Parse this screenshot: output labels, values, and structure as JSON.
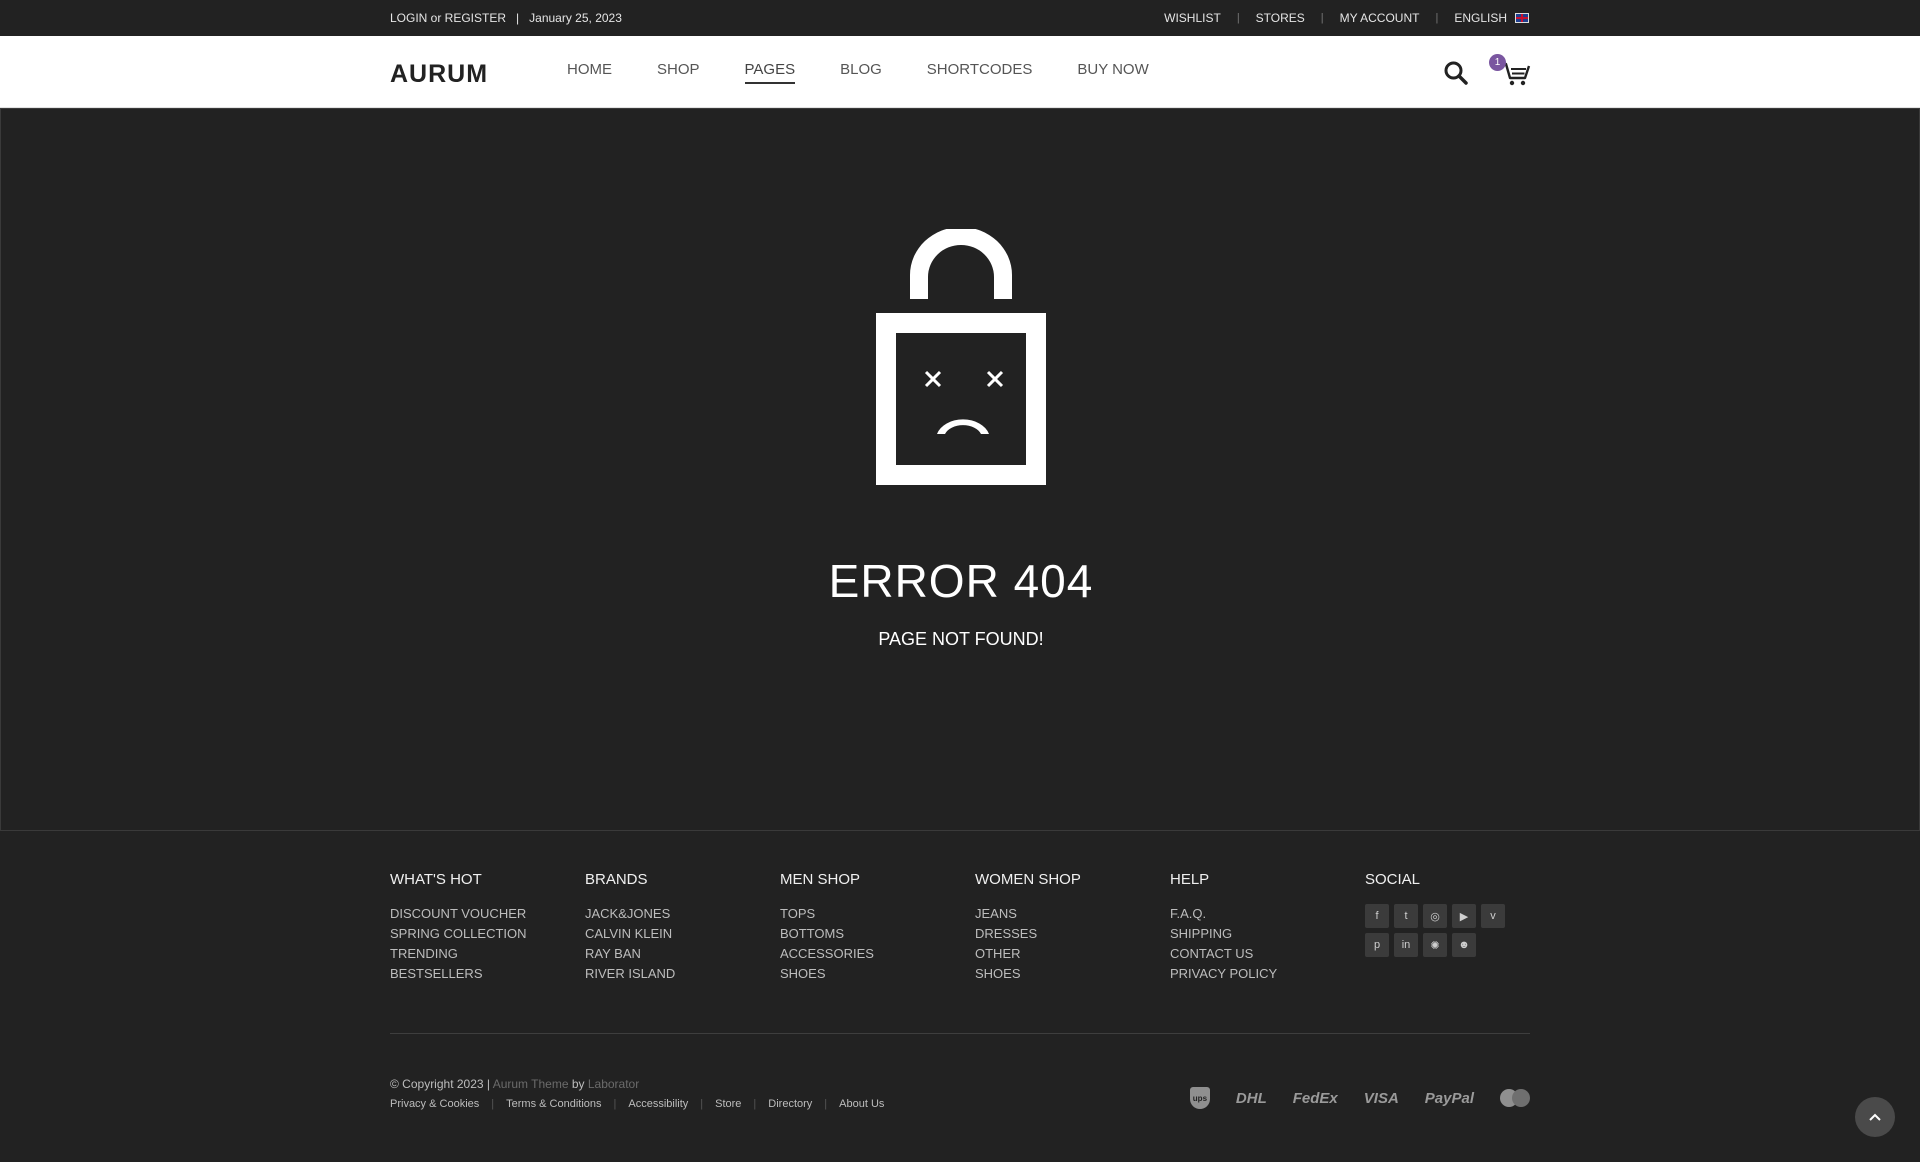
{
  "topbar": {
    "login": "LOGIN or REGISTER",
    "divider": "|",
    "date": "January 25, 2023",
    "links": [
      "WISHLIST",
      "STORES",
      "MY ACCOUNT"
    ],
    "language": "ENGLISH",
    "sep": "|"
  },
  "header": {
    "logo": "AURUM",
    "nav": [
      "HOME",
      "SHOP",
      "PAGES",
      "BLOG",
      "SHORTCODES",
      "BUY NOW"
    ],
    "active_nav": "PAGES",
    "cart_count": "1",
    "icons": {
      "search": "search-icon",
      "cart": "cart-icon"
    }
  },
  "main": {
    "title": "ERROR 404",
    "subtitle": "PAGE NOT FOUND!"
  },
  "footer": {
    "columns": [
      {
        "title": "WHAT'S HOT",
        "links": [
          "DISCOUNT VOUCHER",
          "SPRING COLLECTION",
          "TRENDING",
          "BESTSELLERS"
        ]
      },
      {
        "title": "BRANDS",
        "links": [
          "JACK&JONES",
          "CALVIN KLEIN",
          "RAY BAN",
          "RIVER ISLAND"
        ]
      },
      {
        "title": "MEN SHOP",
        "links": [
          "TOPS",
          "BOTTOMS",
          "ACCESSORIES",
          "SHOES"
        ]
      },
      {
        "title": "WOMEN SHOP",
        "links": [
          "JEANS",
          "DRESSES",
          "OTHER",
          "SHOES"
        ]
      },
      {
        "title": "HELP",
        "links": [
          "F.A.Q.",
          "SHIPPING",
          "CONTACT US",
          "PRIVACY POLICY"
        ]
      }
    ],
    "social": {
      "title": "SOCIAL",
      "icons": [
        "facebook-icon",
        "twitter-icon",
        "instagram-icon",
        "youtube-icon",
        "vimeo-icon",
        "pinterest-icon",
        "linkedin-icon",
        "dribbble-icon",
        "snapchat-icon"
      ],
      "glyphs": [
        "f",
        "t",
        "◎",
        "▶",
        "v",
        "p",
        "in",
        "✺",
        "☻"
      ]
    },
    "copyright": {
      "prefix": "© Copyright 2023 | ",
      "theme": "Aurum Theme",
      "by": " by ",
      "author": "Laborator"
    },
    "legal": [
      "Privacy & Cookies",
      "Terms & Conditions",
      "Accessibility",
      "Store",
      "Directory",
      "About Us"
    ],
    "legal_sep": "|",
    "payments": [
      "DHL",
      "FedEx",
      "VISA",
      "PayPal"
    ],
    "ups": "ups"
  },
  "colors": {
    "background": "#222222",
    "header": "#ffffff",
    "cart_badge": "#7a56a0"
  }
}
